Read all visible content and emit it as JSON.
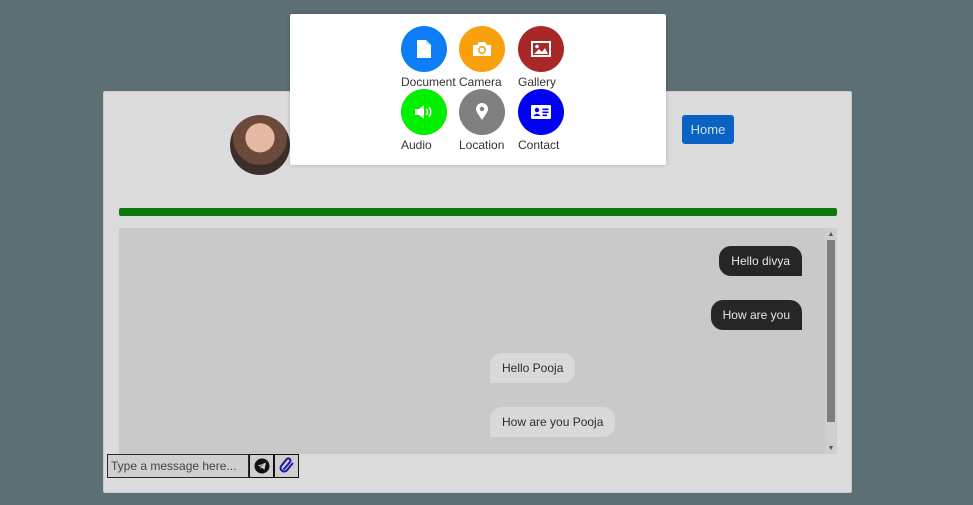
{
  "header": {
    "home_label": "Home"
  },
  "progress": {
    "value": 1.0,
    "color": "#0b7a0b"
  },
  "messages": [
    {
      "text": "Hello divya",
      "direction": "sent"
    },
    {
      "text": "How are you",
      "direction": "sent"
    },
    {
      "text": "Hello Pooja",
      "direction": "received"
    },
    {
      "text": "How are you Pooja",
      "direction": "received"
    }
  ],
  "composer": {
    "placeholder": "Type a message here...",
    "send_icon": "telegram-send-icon",
    "attach_icon": "paperclip-icon"
  },
  "attachment_menu": {
    "items": [
      {
        "label": "Document",
        "icon": "file-icon",
        "color": "#0d7ef5"
      },
      {
        "label": "Camera",
        "icon": "camera-icon",
        "color": "#f8a10d"
      },
      {
        "label": "Gallery",
        "icon": "image-icon",
        "color": "#a82828"
      },
      {
        "label": "Audio",
        "icon": "speaker-icon",
        "color": "#00f000"
      },
      {
        "label": "Location",
        "icon": "map-pin-icon",
        "color": "#808080"
      },
      {
        "label": "Contact",
        "icon": "contact-card-icon",
        "color": "#0000f5"
      }
    ]
  }
}
